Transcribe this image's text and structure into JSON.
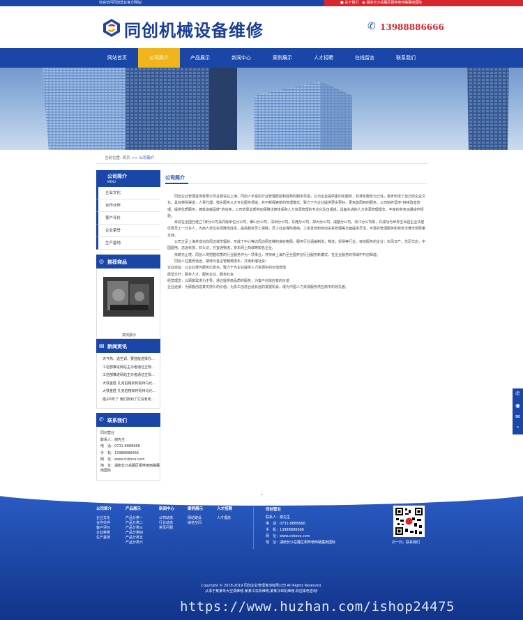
{
  "topbar": {
    "welcome": "欢迎访问同创营业官方网站!",
    "about": "关于我们",
    "address": "湖南长沙岳麓区桐梓坡西路麓南国际"
  },
  "header": {
    "logo_text": "同创机械设备维修",
    "phone": "13988886666"
  },
  "nav": {
    "items": [
      "网站首页",
      "公司简介",
      "产品展示",
      "新闻中心",
      "案例展示",
      "人才招聘",
      "在线留言",
      "联系我们"
    ],
    "active_index": 1
  },
  "breadcrumb": {
    "prefix": "当前位置:",
    "home": "首页",
    "sep": ">>",
    "current": "公司简介"
  },
  "sidebar": {
    "about": {
      "title": "公司简介",
      "subtitle": "MENU",
      "items": [
        "企业文化",
        "合作伙伴",
        "客户评价",
        "企业荣誉",
        "生产基地"
      ]
    },
    "recommend": {
      "title": "推荐商品",
      "caption": "案例展示"
    },
    "news": {
      "title": "新闻资讯",
      "items": [
        "天气热、选空调，要选能选择办...",
        "工信部推进网站主办者通过正规...",
        "工信部推进网站主办者通过正规...",
        "大铁金胜 扎克伯格如何看待马化...",
        "大铁金胜 扎克伯格如何看待马化...",
        "猎子6年了 我们找到了它没有死..."
      ]
    },
    "contact": {
      "title": "联系我们",
      "company": "同创营业",
      "person": "联系人：谢先生",
      "tel": "电　话：0731-8888666",
      "mobile": "手　机：13988886666",
      "web": "网　址：www.cnboco.com",
      "address": "地　址：湖南长沙岳麓区桐梓坡西路麓南国际"
    }
  },
  "main": {
    "title": "公司简介",
    "paragraphs": [
      "　　同创企业管理咨询有限公司总部设在上海，同创人丰富的行业管理经验和成熟的服务举措，以为企业提供集约化服务，标准化服务为己任，逐步形成了自己的企业文化，具有特别渠道，人事代理，猎头服务三大专业服务领域，并不断探索新的管理模式，致力于为企业提供更多更好，更完善周到的服务。公司始终坚持“持续改善管理，提供优质服务，铸就卓越品牌”的信条，公司依靠总部劳动保障法律体系和人力资源管理的专业化队伍组成，具备先进的人力资源管理理念，丰富的劳务派遣操作经验。",
      "　　目前在全国已建立7家分公司及同级单位分公司，佛山分公司，深圳分公司，东莞分公司，郑州分公司，成都分公司，浙江分公司等，并成功与世界五百强企业共建优秀员工一万多人，为用人单位实现降低成本，提高服务员工保障，员工社会保险缴纳，工资发放和劳动关系管理等方面提供灵活，可靠的管理服务和劳务法律法规政策支持。",
      "　　公司立足上海并成功向周边城市辐射，形成了中心等边周边网支撑的良好格局，服务行业涵盖制造，物流，贸易等行业，目前服务的企业：东风日产，优尼华庄，中国国电，志远科技，石头记，万宜通物流，京东网上商城等知名企业。",
      "　　依耕无止境，同创人将把握优质的行业服务作为一项事业，并持续上海乃至全国开创行业服务新模式，在企业服务的领域中开创辉煌。",
      "　　同创人任重而道远，期待与各企管精英携手，共谱和谐社会！",
      "企业宗旨：以企业使为服务出发点，致力于为企业提供人力资源中的价值增值",
      "经营方针：服务人才，服务企业，服务社会",
      "经营理念：以顾客需求为主导，通过提供高品质的服务，为客户创造应有的价值",
      "企业远景：为顾客创造真实持久的价值，为员工创造合适长远的发展机会，成为中国人力资源服务供应商中的领先者。"
    ]
  },
  "footer": {
    "columns": [
      {
        "title": "公司简介",
        "items": [
          "企业文化",
          "合作伙伴",
          "客户评价",
          "企业荣誉",
          "生产基地"
        ]
      },
      {
        "title": "产品展示",
        "items": [
          "产品分类一",
          "产品分类二",
          "产品分类三",
          "产品分类四",
          "产品分类五",
          "产品分类六"
        ]
      },
      {
        "title": "新闻中心",
        "items": [
          "公司动态",
          "行业动态",
          "常见问题"
        ]
      },
      {
        "title": "案例展示",
        "items": [
          "网站建设",
          "域名空间"
        ]
      },
      {
        "title": "人才招聘",
        "items": [
          "人才理念"
        ]
      }
    ],
    "contact": {
      "company": "同创营业",
      "person": "联系人：谢先生",
      "tel": "电　话：0731-8888666",
      "mobile": "手　机：13988886666",
      "web": "网　址：www.cnboco.com",
      "address": "地　址：湖南长沙岳麓区桐梓坡西路麓南国际"
    },
    "qr_caption": "扫一扫，联系我们",
    "copyright": "Copyright © 2018-2019 同创企业管理咨询有限公司 All Rights Reserved.",
    "copyright2": "从事于某某年大空调维修,某某冷冻机维修,某某冷却机维修,欢迎来电咨询!",
    "watermark": "https://www.huzhan.com/ishop24475"
  },
  "colors": {
    "brand_blue": "#1a46a8",
    "accent_yellow": "#f1b41a",
    "accent_red": "#d8262e"
  }
}
